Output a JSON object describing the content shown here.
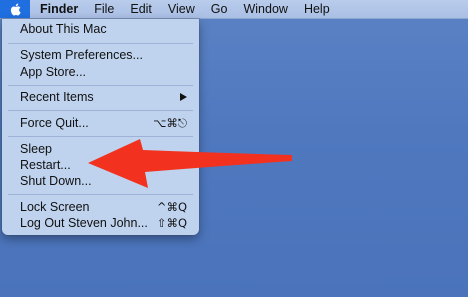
{
  "menubar": {
    "apple_icon": "apple-icon",
    "items": [
      "Finder",
      "File",
      "Edit",
      "View",
      "Go",
      "Window",
      "Help"
    ]
  },
  "apple_menu": {
    "about": "About This Mac",
    "system_preferences": "System Preferences...",
    "app_store": "App Store...",
    "recent_items": "Recent Items",
    "force_quit": "Force Quit...",
    "force_quit_shortcut": "⌥⌘⎋",
    "sleep": "Sleep",
    "restart": "Restart...",
    "shut_down": "Shut Down...",
    "lock_screen": "Lock Screen",
    "lock_screen_shortcut": "^⌘Q",
    "log_out": "Log Out Steven John...",
    "log_out_shortcut": "⇧⌘Q"
  },
  "annotation": {
    "arrow_color": "#f2321e"
  },
  "colors": {
    "desktop": "#4f78bf",
    "menu_bg": "#c4d6f0",
    "apple_highlight": "#1f6fe0"
  }
}
